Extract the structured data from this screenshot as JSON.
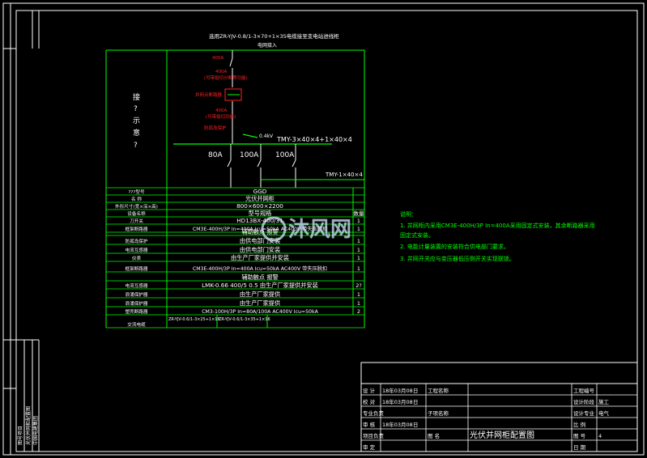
{
  "colors": {
    "background": "#000000",
    "frame": "#ffffff",
    "table": "#00ff00",
    "circuit": "#ffffff",
    "annotation_red": "#ff2020",
    "notes": "#00ff00",
    "watermark": "#cfe8ff"
  },
  "diagram": {
    "title": "选用ZR-YJV-0.8/1-3×70+1×35电缆接至变电站进线柜",
    "bus_label": "电网接入",
    "left_note": [
      "接",
      "?",
      "示",
      "意",
      "?"
    ],
    "red_labels": [
      "400A",
      "400A",
      "(可带投切分断等功能)",
      "并网点断路器",
      "400A",
      "(可带投切功能)",
      "防孤岛保护"
    ],
    "bus_right_label": "TMY-3×40×4+1×40×4",
    "bus_left_label": "0.4kV",
    "branches": [
      "80A",
      "100A",
      "100A"
    ],
    "lower_bus_label": "TMY-1×40×4"
  },
  "table_rows": [
    {
      "label": "???型号",
      "value": "GGD",
      "qty": ""
    },
    {
      "label": "名    称",
      "value": "光伏并网柜",
      "qty": ""
    },
    {
      "label": "外形尺寸(宽×深×高)",
      "value": "800×600×2200",
      "qty": ""
    },
    {
      "label": "设备名称",
      "value": "型号规格",
      "qty": "数量"
    },
    {
      "label": "刀开关",
      "value": "HD13BX-400/31",
      "qty": "1"
    },
    {
      "label": "框架断路器",
      "value": "CM3E-400H/3P  In=400A  Icu=50kA  AC400V 带失压脱扣",
      "qty": "1"
    },
    {
      "label": "",
      "value": "辅助触点  报警",
      "qty": ""
    },
    {
      "label": "防孤岛保护",
      "value": "由供电部门安装",
      "qty": "1"
    },
    {
      "label": "电流互感器",
      "value": "由供电部门安装",
      "qty": "1"
    },
    {
      "label": "仪表",
      "value": "由生产厂家提供并安装",
      "qty": "1"
    },
    {
      "label": "框架断路器",
      "value": "CM3E-400H/3P  In=400A  Icu=50kA  AC400V 带失压脱扣",
      "qty": "1"
    },
    {
      "label": "",
      "value": "辅助触点  报警",
      "qty": ""
    },
    {
      "label": "电流互感器",
      "value": "LMK-0.66   400/5  0.5  由生产厂家提供并安装",
      "qty": "2?"
    },
    {
      "label": "浪涌保护器",
      "value": "由生产厂家提供",
      "qty": "1"
    },
    {
      "label": "浪涌保护器",
      "value": "由生产厂家提供",
      "qty": "1"
    },
    {
      "label": "塑壳断路器",
      "value": "CM3-100H/3P  In=80A/100A  AC400V  Icu=50kA",
      "qty": "2"
    },
    {
      "label": "交流电缆",
      "value": "",
      "qty": ""
    }
  ],
  "cable_cells": [
    "ZR-YJV-0.6/1-3×25+1×16",
    "ZR-YJV-0.6/1-3×35+1×16"
  ],
  "notes": {
    "heading": "说明：",
    "lines": [
      "1. 并网柜内采用CM3E-400H/3P  In=400A采用固定式安装，其余断路器采用",
      "   固定式安装。",
      "2. 电能计量装置的安装符合供电部门要求。",
      "3. 并网开关应与变压器低压侧开关实现联锁。"
    ]
  },
  "watermark": "沐风网",
  "title_block": {
    "rows": [
      [
        "设  计",
        "18年03月08日",
        "工程名称",
        "",
        "工程编号",
        ""
      ],
      [
        "校  对",
        "18年03月08日",
        "",
        "",
        "设计阶段",
        "施工"
      ],
      [
        "专业负责",
        "",
        "子项名称",
        "",
        "设计专业",
        "电气"
      ],
      [
        "审  核",
        "18年03月08日",
        "",
        "",
        "比  例",
        ""
      ],
      [
        "项目负责",
        "",
        "图  名",
        "光伏并网柜配置图",
        "图  号",
        "4"
      ],
      [
        "审  定",
        "",
        "",
        "",
        "日  期",
        ""
      ]
    ]
  },
  "side_strip": [
    "图号项目",
    "光伏并网柜配置图",
    "中国电建集团"
  ]
}
